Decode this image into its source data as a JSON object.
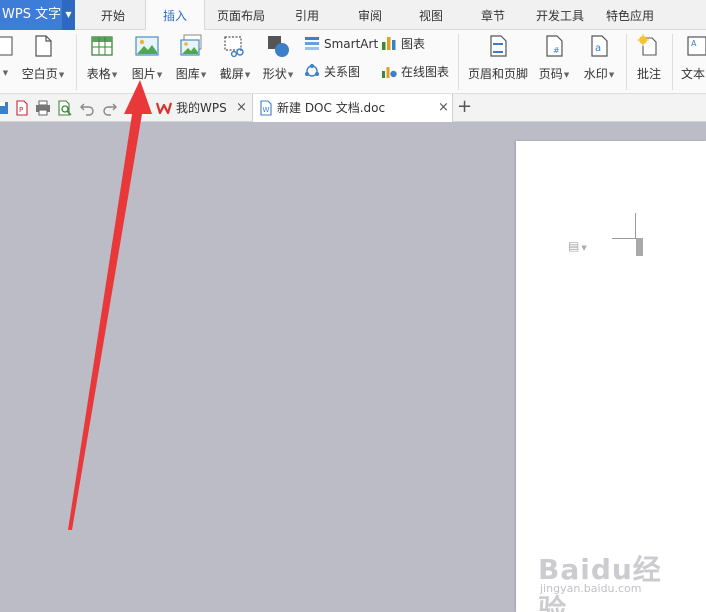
{
  "app": {
    "name": "WPS 文字"
  },
  "menu": {
    "tabs": [
      {
        "label": "开始"
      },
      {
        "label": "插入"
      },
      {
        "label": "页面布局"
      },
      {
        "label": "引用"
      },
      {
        "label": "审阅"
      },
      {
        "label": "视图"
      },
      {
        "label": "章节"
      },
      {
        "label": "开发工具"
      },
      {
        "label": "特色应用"
      }
    ],
    "active_tab": "插入"
  },
  "ribbon": {
    "blank_page": "空白页",
    "table": "表格",
    "picture": "图片",
    "gallery": "图库",
    "screenshot": "截屏",
    "shapes": "形状",
    "smartart": "SmartArt",
    "chart": "图表",
    "relation": "关系图",
    "online_chart": "在线图表",
    "header_footer": "页眉和页脚",
    "page_number": "页码",
    "watermark": "水印",
    "comment": "批注",
    "text": "文本"
  },
  "doc_tabs": [
    {
      "label": "我的WPS"
    },
    {
      "label": "新建 DOC 文档.doc"
    }
  ],
  "watermark": {
    "brand": "Baidu经验",
    "url": "jingyan.baidu.com"
  },
  "colors": {
    "app_blue": "#3d7cd8",
    "active_tab_text": "#2f6bd0",
    "arrow": "#e8383a",
    "workspace": "#bcbcc6"
  }
}
